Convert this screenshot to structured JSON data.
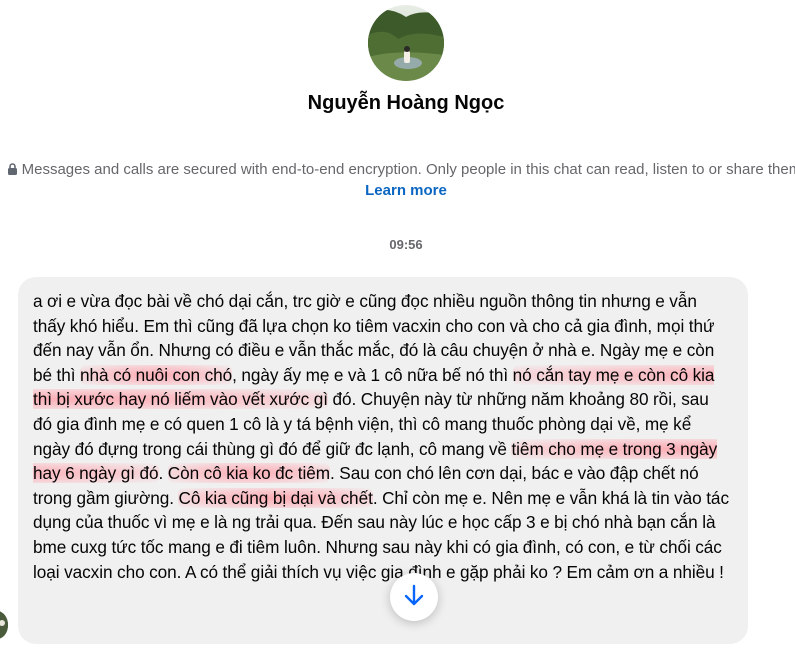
{
  "contact": {
    "name": "Nguyễn Hoàng Ngọc"
  },
  "encryption": {
    "notice": "Messages and calls are secured with end-to-end encryption. Only people in this chat can read, listen to or share them.",
    "learn_more": "Learn more"
  },
  "timestamp": "09:56",
  "message": {
    "segments": [
      {
        "t": "a ơi e vừa đọc bài về chó dại cắn, trc giờ e cũng đọc nhiều nguồn thông tin nhưng e vẫn thấy khó hiểu. Em thì cũng đã lựa chọn ko tiêm vacxin cho con và cho cả gia đình, mọi thứ đến nay vẫn ổn. Nhưng có điều e vẫn thắc mắc, đó là câu chuyện ở nhà e. Ngày mẹ e còn bé thì ",
        "h": false
      },
      {
        "t": "nhà có nuôi con chó",
        "h": true
      },
      {
        "t": ", ngày ấy mẹ e và 1 cô nữa bế nó thì ",
        "h": false
      },
      {
        "t": "nó cắn tay mẹ e còn cô kia thì bị xước hay nó liếm vào vết xước gì",
        "h": true
      },
      {
        "t": " đó. Chuyện này từ những năm khoảng 80 rồi, sau đó gia đình mẹ e có quen 1 cô là y tá bệnh viện, thì cô mang thuốc phòng dại về, mẹ kể ngày đó đựng trong cái thùng gì đó để giữ đc lạnh, cô mang về ",
        "h": false
      },
      {
        "t": "tiêm cho mẹ e trong 3 ngày hay 6 ngày gì đó",
        "h": true
      },
      {
        "t": ". ",
        "h": false
      },
      {
        "t": "Còn cô kia ko đc tiêm",
        "h": true
      },
      {
        "t": ". Sau con chó lên cơn dại, bác e vào đập chết nó trong gầm giường. ",
        "h": false
      },
      {
        "t": "Cô kia cũng bị dại và chết",
        "h": true
      },
      {
        "t": ". Chỉ còn mẹ e. Nên mẹ e vẫn khá là tin vào tác dụng của thuốc vì mẹ e là ng trải qua. Đến sau này lúc e học cấp 3 e bị chó nhà bạn cắn là bme cuxg tức tốc mang e đi tiêm luôn. Nhưng sau này khi có gia đình, có con, e từ chối các loại vacxin cho con. A có thể giải thích vụ việc gia đình e gặp phải ko ? Em cảm ơn a nhiều !",
        "h": false
      }
    ]
  },
  "icons": {
    "lock": "lock-icon",
    "scroll": "arrow-down-icon"
  },
  "colors": {
    "bubble": "#f0f0f0",
    "link": "#0a66c2",
    "highlight": "#ff98a4",
    "muted": "#65676b"
  }
}
